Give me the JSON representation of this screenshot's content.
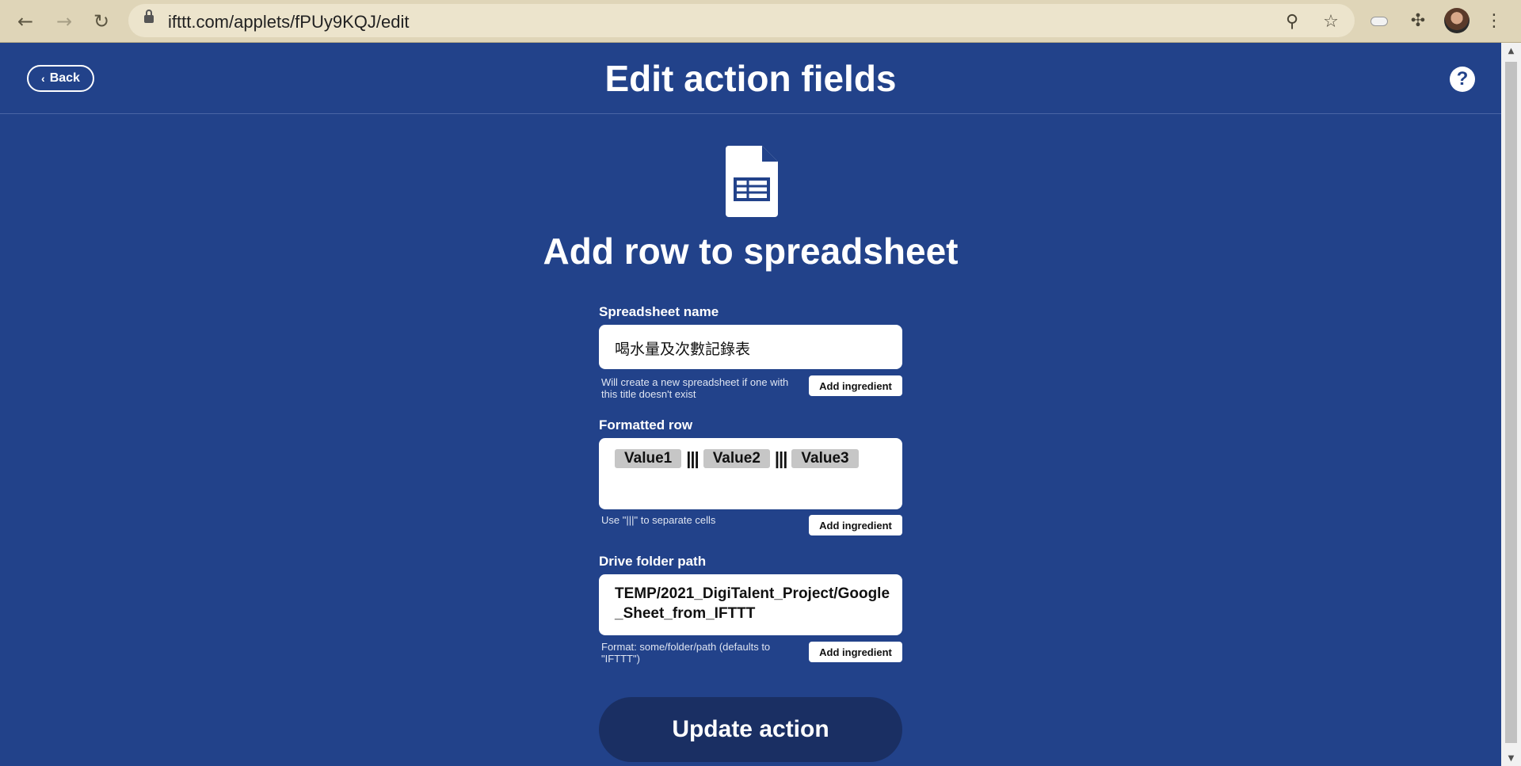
{
  "browser": {
    "url": "ifttt.com/applets/fPUy9KQJ/edit",
    "back_glyph": "←",
    "forward_glyph": "→",
    "reload_glyph": "↻",
    "zoom_glyph": "⚲",
    "star_glyph": "☆",
    "puzzle_glyph": "✣",
    "menu_glyph": "⋮",
    "icons": [
      "back-icon",
      "forward-icon",
      "reload-icon",
      "lock-icon",
      "zoom-icon",
      "star-icon",
      "extension-icon",
      "puzzle-icon",
      "avatar",
      "menu-icon"
    ]
  },
  "header": {
    "back_label": "Back",
    "back_chevron": "‹",
    "title": "Edit action fields",
    "help_glyph": "?"
  },
  "action": {
    "title": "Add row to spreadsheet",
    "icon": "google-sheets-icon"
  },
  "fields": {
    "spreadsheet_name": {
      "label": "Spreadsheet name",
      "value": "喝水量及次數記錄表",
      "helper": "Will create a new spreadsheet if one with this title doesn't exist",
      "ingredient_label": "Add ingredient"
    },
    "formatted_row": {
      "label": "Formatted row",
      "tags": [
        "Value1",
        "Value2",
        "Value3"
      ],
      "separator": "|||",
      "helper": "Use \"|||\" to separate cells",
      "ingredient_label": "Add ingredient"
    },
    "drive_folder_path": {
      "label": "Drive folder path",
      "value": "TEMP/2021_DigiTalent_Project/Google_Sheet_from_IFTTT",
      "helper": "Format: some/folder/path (defaults to \"IFTTT\")",
      "ingredient_label": "Add ingredient"
    }
  },
  "submit": {
    "label": "Update action"
  },
  "colors": {
    "page_bg": "#22428a",
    "button_dark": "#1a2f63",
    "tag_bg": "#c6c6c6",
    "chrome_bg": "#dfd5b8"
  }
}
